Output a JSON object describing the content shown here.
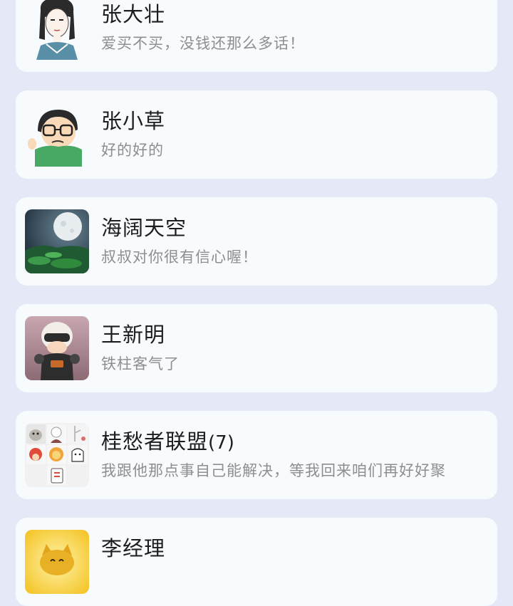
{
  "chats": [
    {
      "name": "张大壮",
      "count": "",
      "message": "爱买不买，没钱还那么多话！",
      "avatar_icon": "girl-sketch-avatar-icon"
    },
    {
      "name": "张小草",
      "count": "",
      "message": "好的好的",
      "avatar_icon": "glasses-cartoon-avatar-icon"
    },
    {
      "name": "海阔天空",
      "count": "",
      "message": "叔叔对你很有信心喔！",
      "avatar_icon": "moon-landscape-avatar-icon"
    },
    {
      "name": "王新明",
      "count": "",
      "message": "铁柱客气了",
      "avatar_icon": "motorcycle-rider-avatar-icon"
    },
    {
      "name": "桂愁者联盟",
      "count": "(7)",
      "message": "我跟他那点事自己能解决，等我回来咱们再好好聚",
      "avatar_icon": "group-grid-avatar-icon"
    },
    {
      "name": "李经理",
      "count": "",
      "message": "",
      "avatar_icon": "lucky-cat-avatar-icon"
    }
  ]
}
